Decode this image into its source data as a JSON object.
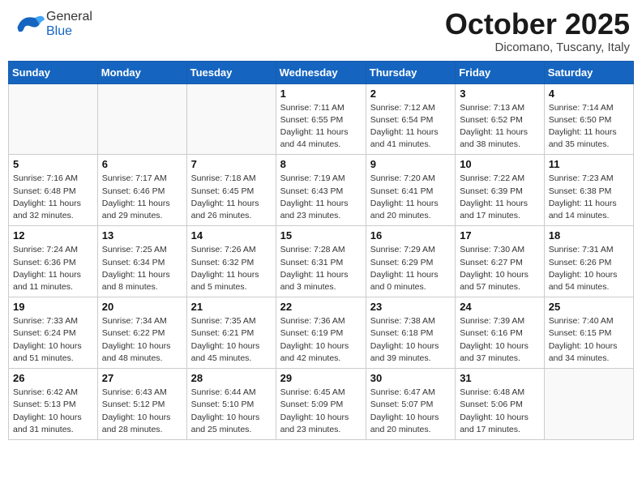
{
  "header": {
    "logo_general": "General",
    "logo_blue": "Blue",
    "month": "October 2025",
    "location": "Dicomano, Tuscany, Italy"
  },
  "weekdays": [
    "Sunday",
    "Monday",
    "Tuesday",
    "Wednesday",
    "Thursday",
    "Friday",
    "Saturday"
  ],
  "weeks": [
    [
      {
        "day": "",
        "info": ""
      },
      {
        "day": "",
        "info": ""
      },
      {
        "day": "",
        "info": ""
      },
      {
        "day": "1",
        "info": "Sunrise: 7:11 AM\nSunset: 6:55 PM\nDaylight: 11 hours and 44 minutes."
      },
      {
        "day": "2",
        "info": "Sunrise: 7:12 AM\nSunset: 6:54 PM\nDaylight: 11 hours and 41 minutes."
      },
      {
        "day": "3",
        "info": "Sunrise: 7:13 AM\nSunset: 6:52 PM\nDaylight: 11 hours and 38 minutes."
      },
      {
        "day": "4",
        "info": "Sunrise: 7:14 AM\nSunset: 6:50 PM\nDaylight: 11 hours and 35 minutes."
      }
    ],
    [
      {
        "day": "5",
        "info": "Sunrise: 7:16 AM\nSunset: 6:48 PM\nDaylight: 11 hours and 32 minutes."
      },
      {
        "day": "6",
        "info": "Sunrise: 7:17 AM\nSunset: 6:46 PM\nDaylight: 11 hours and 29 minutes."
      },
      {
        "day": "7",
        "info": "Sunrise: 7:18 AM\nSunset: 6:45 PM\nDaylight: 11 hours and 26 minutes."
      },
      {
        "day": "8",
        "info": "Sunrise: 7:19 AM\nSunset: 6:43 PM\nDaylight: 11 hours and 23 minutes."
      },
      {
        "day": "9",
        "info": "Sunrise: 7:20 AM\nSunset: 6:41 PM\nDaylight: 11 hours and 20 minutes."
      },
      {
        "day": "10",
        "info": "Sunrise: 7:22 AM\nSunset: 6:39 PM\nDaylight: 11 hours and 17 minutes."
      },
      {
        "day": "11",
        "info": "Sunrise: 7:23 AM\nSunset: 6:38 PM\nDaylight: 11 hours and 14 minutes."
      }
    ],
    [
      {
        "day": "12",
        "info": "Sunrise: 7:24 AM\nSunset: 6:36 PM\nDaylight: 11 hours and 11 minutes."
      },
      {
        "day": "13",
        "info": "Sunrise: 7:25 AM\nSunset: 6:34 PM\nDaylight: 11 hours and 8 minutes."
      },
      {
        "day": "14",
        "info": "Sunrise: 7:26 AM\nSunset: 6:32 PM\nDaylight: 11 hours and 5 minutes."
      },
      {
        "day": "15",
        "info": "Sunrise: 7:28 AM\nSunset: 6:31 PM\nDaylight: 11 hours and 3 minutes."
      },
      {
        "day": "16",
        "info": "Sunrise: 7:29 AM\nSunset: 6:29 PM\nDaylight: 11 hours and 0 minutes."
      },
      {
        "day": "17",
        "info": "Sunrise: 7:30 AM\nSunset: 6:27 PM\nDaylight: 10 hours and 57 minutes."
      },
      {
        "day": "18",
        "info": "Sunrise: 7:31 AM\nSunset: 6:26 PM\nDaylight: 10 hours and 54 minutes."
      }
    ],
    [
      {
        "day": "19",
        "info": "Sunrise: 7:33 AM\nSunset: 6:24 PM\nDaylight: 10 hours and 51 minutes."
      },
      {
        "day": "20",
        "info": "Sunrise: 7:34 AM\nSunset: 6:22 PM\nDaylight: 10 hours and 48 minutes."
      },
      {
        "day": "21",
        "info": "Sunrise: 7:35 AM\nSunset: 6:21 PM\nDaylight: 10 hours and 45 minutes."
      },
      {
        "day": "22",
        "info": "Sunrise: 7:36 AM\nSunset: 6:19 PM\nDaylight: 10 hours and 42 minutes."
      },
      {
        "day": "23",
        "info": "Sunrise: 7:38 AM\nSunset: 6:18 PM\nDaylight: 10 hours and 39 minutes."
      },
      {
        "day": "24",
        "info": "Sunrise: 7:39 AM\nSunset: 6:16 PM\nDaylight: 10 hours and 37 minutes."
      },
      {
        "day": "25",
        "info": "Sunrise: 7:40 AM\nSunset: 6:15 PM\nDaylight: 10 hours and 34 minutes."
      }
    ],
    [
      {
        "day": "26",
        "info": "Sunrise: 6:42 AM\nSunset: 5:13 PM\nDaylight: 10 hours and 31 minutes."
      },
      {
        "day": "27",
        "info": "Sunrise: 6:43 AM\nSunset: 5:12 PM\nDaylight: 10 hours and 28 minutes."
      },
      {
        "day": "28",
        "info": "Sunrise: 6:44 AM\nSunset: 5:10 PM\nDaylight: 10 hours and 25 minutes."
      },
      {
        "day": "29",
        "info": "Sunrise: 6:45 AM\nSunset: 5:09 PM\nDaylight: 10 hours and 23 minutes."
      },
      {
        "day": "30",
        "info": "Sunrise: 6:47 AM\nSunset: 5:07 PM\nDaylight: 10 hours and 20 minutes."
      },
      {
        "day": "31",
        "info": "Sunrise: 6:48 AM\nSunset: 5:06 PM\nDaylight: 10 hours and 17 minutes."
      },
      {
        "day": "",
        "info": ""
      }
    ]
  ]
}
